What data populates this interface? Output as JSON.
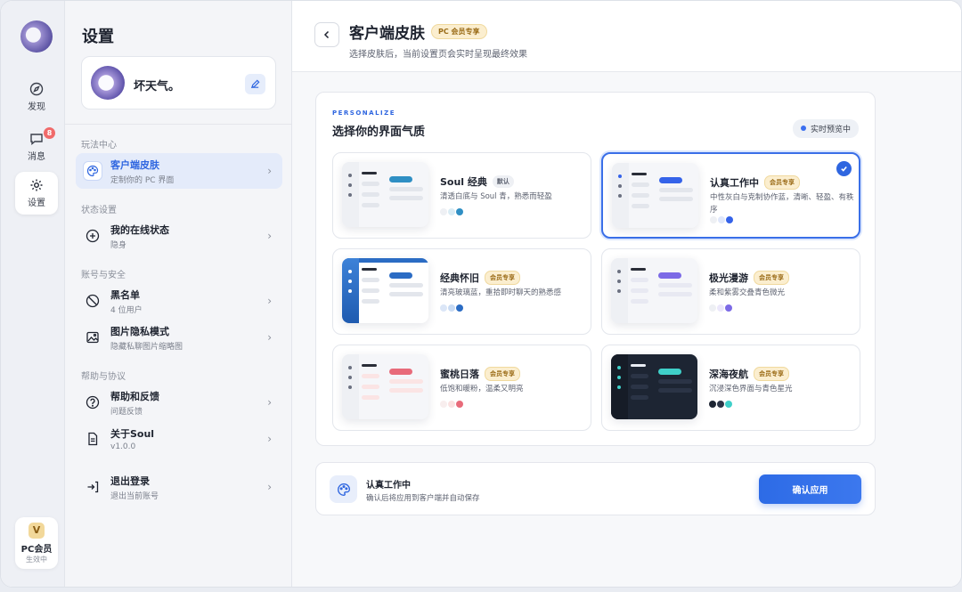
{
  "rail": {
    "items": [
      {
        "label": "发现",
        "icon": "compass-icon"
      },
      {
        "label": "消息",
        "icon": "chat-icon",
        "badge": "8"
      },
      {
        "label": "设置",
        "icon": "gear-icon"
      }
    ],
    "vip": {
      "title": "PC会员",
      "status": "生效中"
    }
  },
  "settings": {
    "title": "设置",
    "profile": {
      "name": "坏天气。"
    },
    "sections": [
      {
        "title": "玩法中心"
      },
      {
        "title": "状态设置"
      },
      {
        "title": "账号与安全"
      },
      {
        "title": "帮助与协议"
      }
    ],
    "items": [
      {
        "title": "客户端皮肤",
        "sub": "定制你的 PC 界面"
      },
      {
        "title": "我的在线状态",
        "sub": "隐身"
      },
      {
        "title": "黑名单",
        "sub": "4 位用户"
      },
      {
        "title": "图片隐私模式",
        "sub": "隐藏私聊图片缩略图"
      },
      {
        "title": "帮助和反馈",
        "sub": "问题反馈"
      },
      {
        "title": "关于Soul",
        "sub": "v1.0.0"
      },
      {
        "title": "退出登录",
        "sub": "退出当前账号"
      }
    ]
  },
  "header": {
    "title": "客户端皮肤",
    "badge": "PC 会员专享",
    "subtitle": "选择皮肤后，当前设置页会实时呈现最终效果"
  },
  "panel": {
    "eyebrow": "PERSONALIZE",
    "title": "选择你的界面气质",
    "live": "实时预览中"
  },
  "themes": [
    {
      "name": "Soul 经典",
      "tag": "默认",
      "desc": "清透白底与 Soul 青，熟悉而轻盈",
      "accent": "#2f8fc4",
      "swatches": [
        "#eef0f4",
        "#d9ecf5",
        "#2f8fc4"
      ]
    },
    {
      "name": "认真工作中",
      "tag": "会员专享",
      "desc": "中性灰白与克制协作蓝，清晰、轻盈、有秩序",
      "accent": "#3563e9",
      "swatches": [
        "#eef0f4",
        "#dfe7fb",
        "#3563e9"
      ],
      "selected": true
    },
    {
      "name": "经典怀旧",
      "tag": "会员专享",
      "desc": "清亮玻璃蓝，重拾即时聊天的熟悉感",
      "accent": "#2b6cc4",
      "swatches": [
        "#dbe6f7",
        "#c9dbf3",
        "#2b6cc4"
      ]
    },
    {
      "name": "极光漫游",
      "tag": "会员专享",
      "desc": "柔和紫雾交叠青色微光",
      "accent": "#7c6ae6",
      "swatches": [
        "#eef0f4",
        "#ebe7fb",
        "#7c6ae6"
      ]
    },
    {
      "name": "蜜桃日落",
      "tag": "会员专享",
      "desc": "低饱和暖粉，温柔又明亮",
      "accent": "#e86b7a",
      "swatches": [
        "#f8eeee",
        "#fbe1e1",
        "#e86b7a"
      ]
    },
    {
      "name": "深海夜航",
      "tag": "会员专享",
      "desc": "沉浸深色界面与青色星光",
      "accent": "#3fd0c9",
      "swatches": [
        "#1d2533",
        "#2b3446",
        "#3fd0c9"
      ]
    }
  ],
  "footer": {
    "title": "认真工作中",
    "subtitle": "确认后将应用到客户端并自动保存",
    "button": "确认应用"
  }
}
